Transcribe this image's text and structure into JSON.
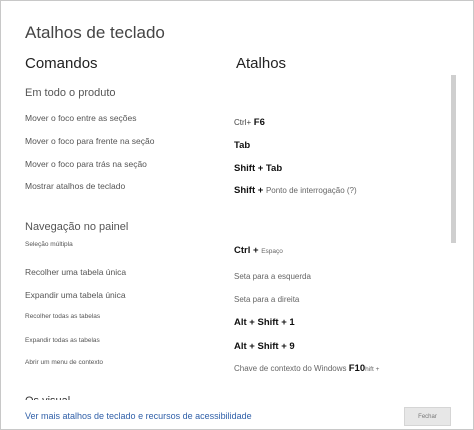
{
  "dialog": {
    "title": "Atalhos de teclado",
    "col_commands": "Comandos",
    "col_shortcuts": "Atalhos"
  },
  "sections": [
    {
      "heading": "Em todo o produto",
      "rows": [
        {
          "label": "Mover o foco entre as seções",
          "keys": [
            {
              "text": "Ctrl+",
              "style": "thin"
            },
            {
              "text": " F6",
              "style": "bold"
            }
          ]
        },
        {
          "label": "Mover o foco para frente na seção",
          "keys": [
            {
              "text": "Tab",
              "style": "bold"
            }
          ]
        },
        {
          "label": "Mover o foco para trás na seção",
          "keys": [
            {
              "text": "Shift + Tab",
              "style": "bold"
            }
          ]
        },
        {
          "label": "Mostrar atalhos de teclado",
          "keys": [
            {
              "text": "Shift + ",
              "style": "bold"
            },
            {
              "text": " Ponto de interrogação (?)",
              "style": "text"
            }
          ]
        }
      ]
    },
    {
      "heading": "Navegação no painel",
      "rows": [
        {
          "label": "Seleção múltipla",
          "small": true,
          "keys": [
            {
              "text": "Ctrl + ",
              "style": "bold"
            },
            {
              "text": "Espaço",
              "style": "text-sm"
            }
          ]
        },
        {
          "label": "Recolher uma tabela única",
          "keys": [
            {
              "text": "Seta para a esquerda",
              "style": "text"
            }
          ]
        },
        {
          "label": "Expandir uma tabela única",
          "keys": [
            {
              "text": "Seta para a direita",
              "style": "text"
            }
          ]
        },
        {
          "label": "Recolher todas as tabelas",
          "small": true,
          "keys": [
            {
              "text": "Alt + Shift + 1",
              "style": "bold"
            }
          ]
        },
        {
          "label": "Expandir todas as tabelas",
          "small": true,
          "keys": [
            {
              "text": "Alt + Shift + 9",
              "style": "bold"
            }
          ]
        },
        {
          "label": "Abrir um menu de contexto",
          "small": true,
          "keys": [
            {
              "text": "Chave de contexto do Windows ",
              "style": "text"
            },
            {
              "text": "F10",
              "style": "bold"
            },
            {
              "text": "hift +",
              "style": "text-sm"
            }
          ]
        }
      ]
    }
  ],
  "next_section_heading": "Os visual",
  "footer": {
    "link_text": "Ver mais atalhos de teclado e recursos de acessibilidade",
    "close_label": "Fechar"
  },
  "colors": {
    "link": "#2f5fa8",
    "button_bg": "#e7e7e7"
  }
}
